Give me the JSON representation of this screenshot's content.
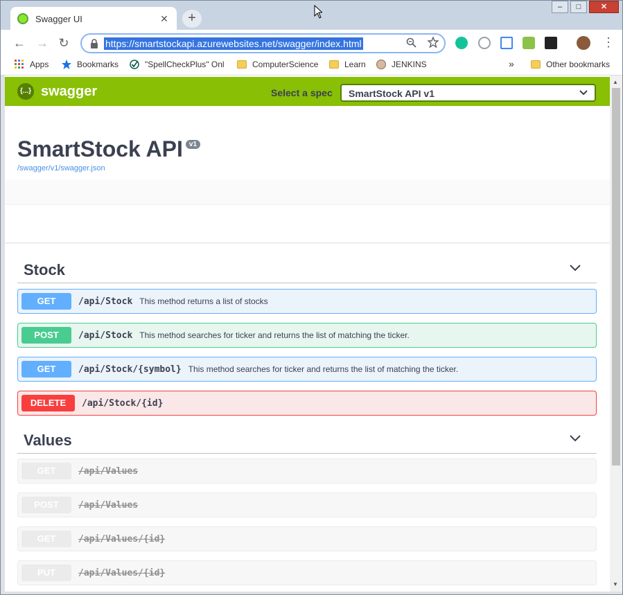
{
  "browser": {
    "tab_title": "Swagger UI",
    "tab_close": "✕",
    "new_tab": "+",
    "window_controls": {
      "minimize": "–",
      "maximize": "□",
      "close": "✕"
    },
    "url": "https://smartstockapi.azurewebsites.net/swagger/index.html",
    "nav": {
      "back": "←",
      "forward": "→",
      "reload": "↻"
    },
    "omnibox_icons": [
      "zoom-icon",
      "star-icon"
    ],
    "extensions": [
      "grammarly-icon",
      "vivaldi-icon",
      "drive-icon",
      "spellcheck-icon",
      "react-icon",
      "profile-avatar"
    ],
    "menu": "⋮"
  },
  "bookmarks": {
    "items": [
      {
        "label": "Apps",
        "icon": "apps-grid-icon"
      },
      {
        "label": "Bookmarks",
        "icon": "star-icon"
      },
      {
        "label": "\"SpellCheckPlus\" Onl",
        "icon": "check-icon"
      },
      {
        "label": "ComputerScience",
        "icon": "folder-icon"
      },
      {
        "label": "Learn",
        "icon": "folder-icon"
      },
      {
        "label": "JENKINS",
        "icon": "jenkins-icon"
      }
    ],
    "overflow": "»",
    "other": "Other bookmarks"
  },
  "swagger": {
    "brand": "swagger",
    "logo_glyph": "{...}",
    "spec_label": "Select a spec",
    "spec_selected": "SmartStock API v1",
    "title": "SmartStock API",
    "version": "v1",
    "spec_url": "/swagger/v1/swagger.json",
    "colors": {
      "topbar": "#89bf04",
      "get": "#61affe",
      "post": "#49cc90",
      "delete": "#f93e3e"
    }
  },
  "sections": [
    {
      "title": "Stock",
      "operations": [
        {
          "method": "GET",
          "path": "/api/Stock",
          "description": "This method returns a list of stocks"
        },
        {
          "method": "POST",
          "path": "/api/Stock",
          "description": "This method searches for ticker and returns the list of matching the ticker."
        },
        {
          "method": "GET",
          "path": "/api/Stock/{symbol}",
          "description": "This method searches for ticker and returns the list of matching the ticker."
        },
        {
          "method": "DELETE",
          "path": "/api/Stock/{id}",
          "description": ""
        }
      ]
    },
    {
      "title": "Values",
      "operations": [
        {
          "method": "GET",
          "path": "/api/Values",
          "description": ""
        },
        {
          "method": "POST",
          "path": "/api/Values",
          "description": ""
        },
        {
          "method": "GET",
          "path": "/api/Values/{id}",
          "description": ""
        },
        {
          "method": "PUT",
          "path": "/api/Values/{id}",
          "description": ""
        }
      ]
    }
  ]
}
